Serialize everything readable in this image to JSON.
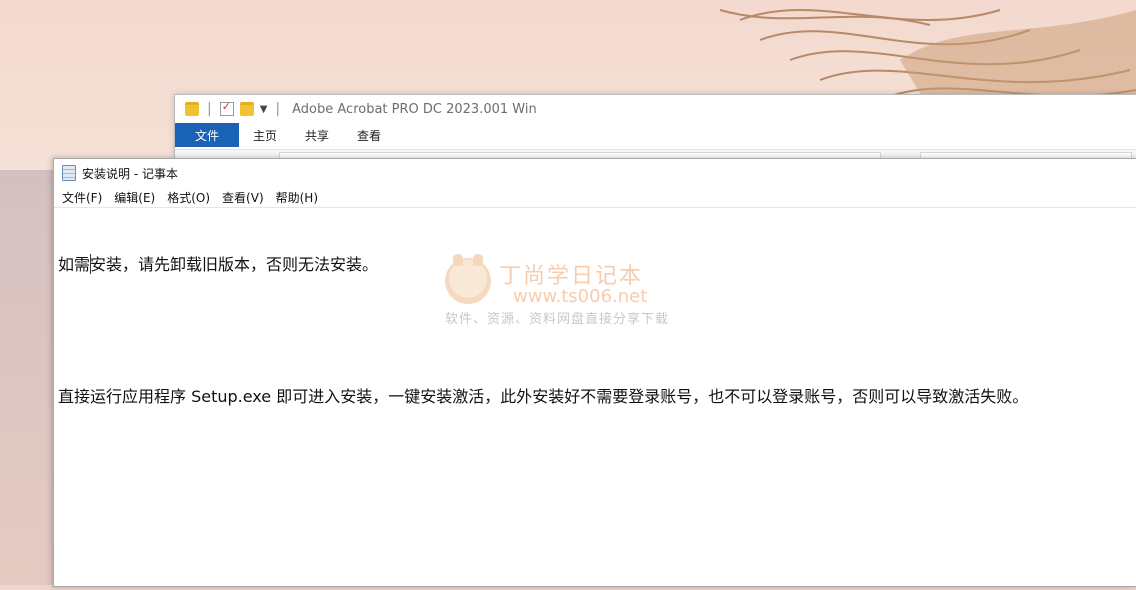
{
  "explorer": {
    "title": "Adobe Acrobat PRO DC 2023.001 Win",
    "ribbon_tabs": [
      "文件",
      "主页",
      "共享",
      "查看"
    ]
  },
  "notepad": {
    "title": "安装说明 - 记事本",
    "menu": [
      "文件(F)",
      "编辑(E)",
      "格式(O)",
      "查看(V)",
      "帮助(H)"
    ],
    "lines": [
      "如需安装，请先卸载旧版本，否则无法安装。",
      "",
      "直接运行应用程序 Setup.exe 即可进入安装，一键安装激活，此外安装好不需要登录账号，也不可以登录账号，否则可以导致激活失败。"
    ]
  },
  "watermark": {
    "brand": "丁尚学日记本",
    "url": "www.ts006.net",
    "tagline": "软件、资源、资料网盘直接分享下载"
  },
  "colors": {
    "ribbon_file_tab": "#1a62b3",
    "watermark_orange": "#f3a26b"
  }
}
